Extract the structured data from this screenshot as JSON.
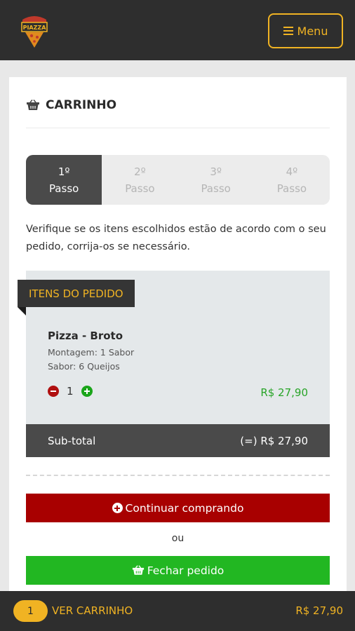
{
  "header": {
    "logo_text": "PIAZZA",
    "menu_label": "Menu"
  },
  "cart": {
    "title": "CARRINHO",
    "steps": [
      {
        "num": "1º",
        "label": "Passo",
        "active": true
      },
      {
        "num": "2º",
        "label": "Passo",
        "active": false
      },
      {
        "num": "3º",
        "label": "Passo",
        "active": false
      },
      {
        "num": "4º",
        "label": "Passo",
        "active": false
      }
    ],
    "intro_text": "Verifique se os itens escolhidos estão de acordo com o seu pedido, corrija-os se necessário."
  },
  "order": {
    "section_label": "ITENS DO PEDIDO",
    "item": {
      "name": "Pizza - Broto",
      "details": [
        "Montagem: 1 Sabor",
        "Sabor: 6 Queijos"
      ],
      "quantity": "1",
      "price": "R$ 27,90"
    },
    "subtotal_label": "Sub-total",
    "subtotal_value": "(=) R$ 27,90"
  },
  "actions": {
    "continue_label": "Continuar comprando",
    "or_text": "ou",
    "close_label": "Fechar pedido"
  },
  "footer": {
    "count": "1",
    "view_cart_label": "VER CARRINHO",
    "total": "R$ 27,90"
  },
  "colors": {
    "accent": "#f0b323",
    "dark": "#2e2e2e",
    "continue_button": "#a80000",
    "close_button": "#22b722",
    "price": "#28a428"
  }
}
